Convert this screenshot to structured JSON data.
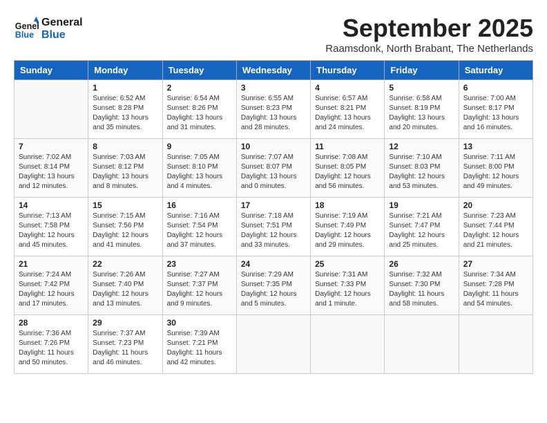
{
  "header": {
    "logo_line1": "General",
    "logo_line2": "Blue",
    "month_year": "September 2025",
    "location": "Raamsdonk, North Brabant, The Netherlands"
  },
  "days_of_week": [
    "Sunday",
    "Monday",
    "Tuesday",
    "Wednesday",
    "Thursday",
    "Friday",
    "Saturday"
  ],
  "weeks": [
    [
      {
        "day": "",
        "info": ""
      },
      {
        "day": "1",
        "info": "Sunrise: 6:52 AM\nSunset: 8:28 PM\nDaylight: 13 hours\nand 35 minutes."
      },
      {
        "day": "2",
        "info": "Sunrise: 6:54 AM\nSunset: 8:26 PM\nDaylight: 13 hours\nand 31 minutes."
      },
      {
        "day": "3",
        "info": "Sunrise: 6:55 AM\nSunset: 8:23 PM\nDaylight: 13 hours\nand 28 minutes."
      },
      {
        "day": "4",
        "info": "Sunrise: 6:57 AM\nSunset: 8:21 PM\nDaylight: 13 hours\nand 24 minutes."
      },
      {
        "day": "5",
        "info": "Sunrise: 6:58 AM\nSunset: 8:19 PM\nDaylight: 13 hours\nand 20 minutes."
      },
      {
        "day": "6",
        "info": "Sunrise: 7:00 AM\nSunset: 8:17 PM\nDaylight: 13 hours\nand 16 minutes."
      }
    ],
    [
      {
        "day": "7",
        "info": "Sunrise: 7:02 AM\nSunset: 8:14 PM\nDaylight: 13 hours\nand 12 minutes."
      },
      {
        "day": "8",
        "info": "Sunrise: 7:03 AM\nSunset: 8:12 PM\nDaylight: 13 hours\nand 8 minutes."
      },
      {
        "day": "9",
        "info": "Sunrise: 7:05 AM\nSunset: 8:10 PM\nDaylight: 13 hours\nand 4 minutes."
      },
      {
        "day": "10",
        "info": "Sunrise: 7:07 AM\nSunset: 8:07 PM\nDaylight: 13 hours\nand 0 minutes."
      },
      {
        "day": "11",
        "info": "Sunrise: 7:08 AM\nSunset: 8:05 PM\nDaylight: 12 hours\nand 56 minutes."
      },
      {
        "day": "12",
        "info": "Sunrise: 7:10 AM\nSunset: 8:03 PM\nDaylight: 12 hours\nand 53 minutes."
      },
      {
        "day": "13",
        "info": "Sunrise: 7:11 AM\nSunset: 8:00 PM\nDaylight: 12 hours\nand 49 minutes."
      }
    ],
    [
      {
        "day": "14",
        "info": "Sunrise: 7:13 AM\nSunset: 7:58 PM\nDaylight: 12 hours\nand 45 minutes."
      },
      {
        "day": "15",
        "info": "Sunrise: 7:15 AM\nSunset: 7:56 PM\nDaylight: 12 hours\nand 41 minutes."
      },
      {
        "day": "16",
        "info": "Sunrise: 7:16 AM\nSunset: 7:54 PM\nDaylight: 12 hours\nand 37 minutes."
      },
      {
        "day": "17",
        "info": "Sunrise: 7:18 AM\nSunset: 7:51 PM\nDaylight: 12 hours\nand 33 minutes."
      },
      {
        "day": "18",
        "info": "Sunrise: 7:19 AM\nSunset: 7:49 PM\nDaylight: 12 hours\nand 29 minutes."
      },
      {
        "day": "19",
        "info": "Sunrise: 7:21 AM\nSunset: 7:47 PM\nDaylight: 12 hours\nand 25 minutes."
      },
      {
        "day": "20",
        "info": "Sunrise: 7:23 AM\nSunset: 7:44 PM\nDaylight: 12 hours\nand 21 minutes."
      }
    ],
    [
      {
        "day": "21",
        "info": "Sunrise: 7:24 AM\nSunset: 7:42 PM\nDaylight: 12 hours\nand 17 minutes."
      },
      {
        "day": "22",
        "info": "Sunrise: 7:26 AM\nSunset: 7:40 PM\nDaylight: 12 hours\nand 13 minutes."
      },
      {
        "day": "23",
        "info": "Sunrise: 7:27 AM\nSunset: 7:37 PM\nDaylight: 12 hours\nand 9 minutes."
      },
      {
        "day": "24",
        "info": "Sunrise: 7:29 AM\nSunset: 7:35 PM\nDaylight: 12 hours\nand 5 minutes."
      },
      {
        "day": "25",
        "info": "Sunrise: 7:31 AM\nSunset: 7:33 PM\nDaylight: 12 hours\nand 1 minute."
      },
      {
        "day": "26",
        "info": "Sunrise: 7:32 AM\nSunset: 7:30 PM\nDaylight: 11 hours\nand 58 minutes."
      },
      {
        "day": "27",
        "info": "Sunrise: 7:34 AM\nSunset: 7:28 PM\nDaylight: 11 hours\nand 54 minutes."
      }
    ],
    [
      {
        "day": "28",
        "info": "Sunrise: 7:36 AM\nSunset: 7:26 PM\nDaylight: 11 hours\nand 50 minutes."
      },
      {
        "day": "29",
        "info": "Sunrise: 7:37 AM\nSunset: 7:23 PM\nDaylight: 11 hours\nand 46 minutes."
      },
      {
        "day": "30",
        "info": "Sunrise: 7:39 AM\nSunset: 7:21 PM\nDaylight: 11 hours\nand 42 minutes."
      },
      {
        "day": "",
        "info": ""
      },
      {
        "day": "",
        "info": ""
      },
      {
        "day": "",
        "info": ""
      },
      {
        "day": "",
        "info": ""
      }
    ]
  ]
}
